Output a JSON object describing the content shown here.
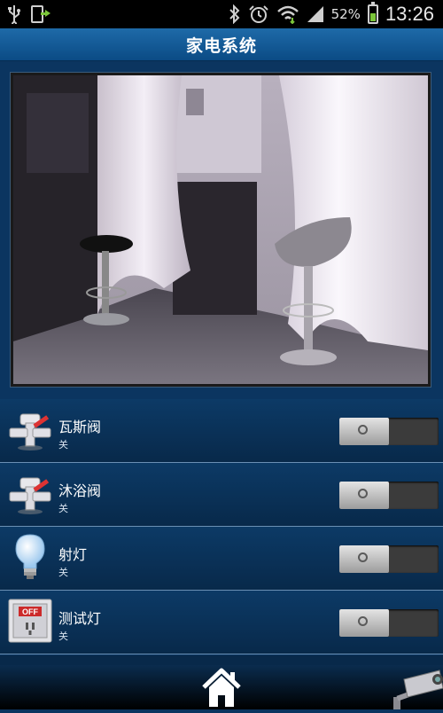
{
  "status_bar": {
    "battery_percent": "52%",
    "time": "13:26",
    "icons": [
      "usb-icon",
      "download-icon",
      "bluetooth-icon",
      "alarm-icon",
      "wifi-icon",
      "signal-icon",
      "battery-icon"
    ]
  },
  "header": {
    "title": "家电系统"
  },
  "camera": {
    "icon": "camera-feed"
  },
  "devices": [
    {
      "name": "瓦斯阀",
      "status": "关",
      "icon": "valve-icon",
      "switch_on": false
    },
    {
      "name": "沐浴阀",
      "status": "关",
      "icon": "valve-icon",
      "switch_on": false
    },
    {
      "name": "射灯",
      "status": "关",
      "icon": "light-bulb-icon",
      "switch_on": false
    },
    {
      "name": "测试灯",
      "status": "关",
      "icon": "off-switch-icon",
      "switch_on": false,
      "icon_text": "OFF"
    }
  ],
  "bottom_nav": {
    "home_icon": "home-icon",
    "camera_icon": "security-camera-icon"
  },
  "colors": {
    "background": "#0b3560",
    "title_bar": "#1e6aa8",
    "status_bar": "#000000"
  }
}
